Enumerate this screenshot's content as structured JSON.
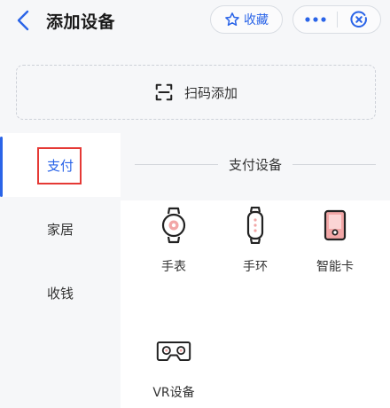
{
  "header": {
    "title": "添加设备",
    "favorite_label": "收藏"
  },
  "scan": {
    "label": "扫码添加"
  },
  "sidebar": {
    "items": [
      {
        "label": "支付"
      },
      {
        "label": "家居"
      },
      {
        "label": "收钱"
      }
    ]
  },
  "section": {
    "title": "支付设备"
  },
  "devices": [
    {
      "label": "手表",
      "icon": "watch-icon"
    },
    {
      "label": "手环",
      "icon": "band-icon"
    },
    {
      "label": "智能卡",
      "icon": "smart-card-icon"
    },
    {
      "label": "VR设备",
      "icon": "vr-headset-icon"
    }
  ],
  "colors": {
    "accent": "#2a64e8",
    "highlight": "#e53935",
    "icon_accent": "#f2a7a7"
  }
}
